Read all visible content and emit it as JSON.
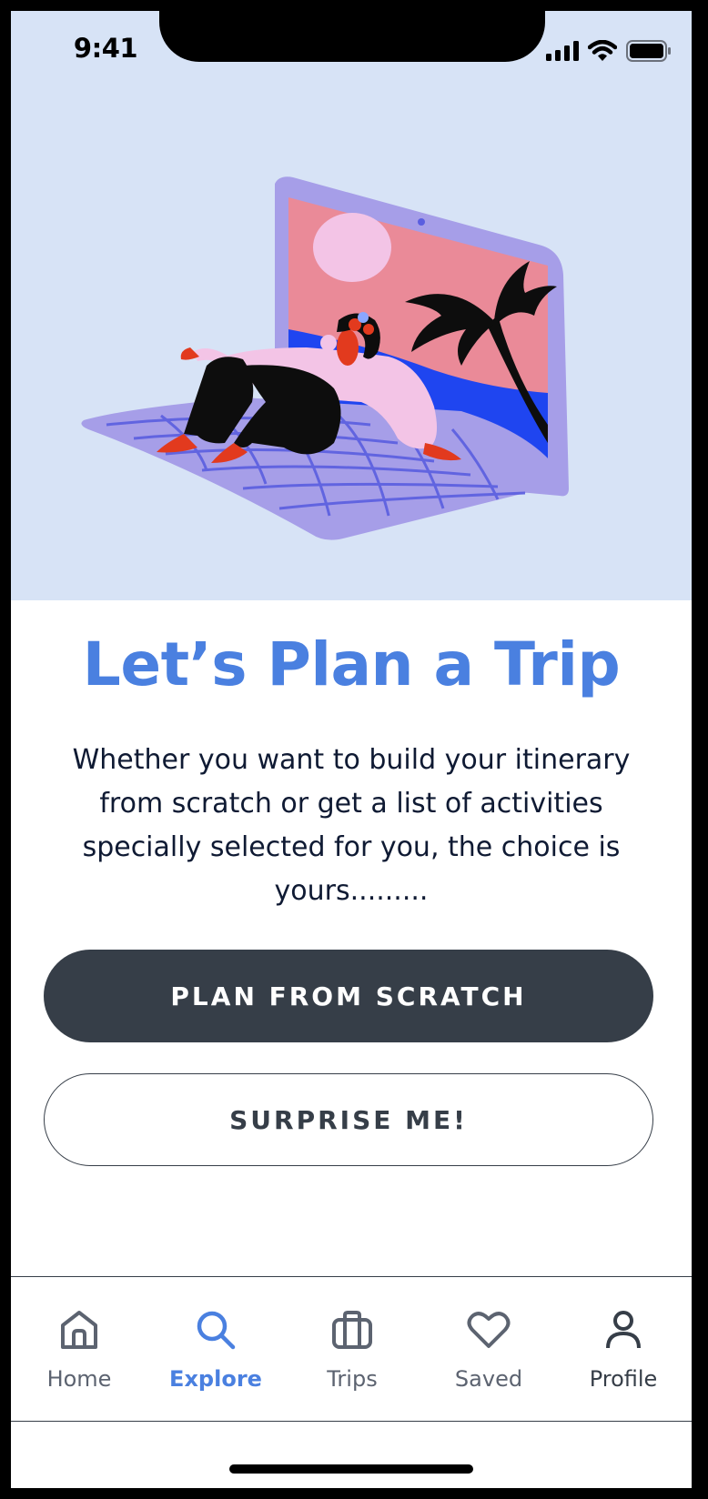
{
  "status_bar": {
    "time": "9:41",
    "icons": [
      "cellular-signal-icon",
      "wifi-icon",
      "battery-icon"
    ]
  },
  "hero": {
    "background": "#d7e3f6",
    "illustration": "woman-lounging-on-laptop-beach-illustration"
  },
  "main": {
    "title": "Let’s Plan a Trip",
    "description": "Whether you want to build your itinerary from scratch or get a list of activities specially selected for you, the choice is yours.........",
    "primary_button": "PLAN FROM SCRATCH",
    "secondary_button": "SURPRISE ME!"
  },
  "tab_bar": {
    "active": "Explore",
    "items": [
      {
        "label": "Home",
        "icon": "home-icon"
      },
      {
        "label": "Explore",
        "icon": "search-icon"
      },
      {
        "label": "Trips",
        "icon": "briefcase-icon"
      },
      {
        "label": "Saved",
        "icon": "heart-icon"
      },
      {
        "label": "Profile",
        "icon": "user-icon"
      }
    ]
  },
  "colors": {
    "accent": "#4a80e0",
    "dark": "#363e48",
    "text": "#0f1a33",
    "inactive": "#5c6370"
  }
}
